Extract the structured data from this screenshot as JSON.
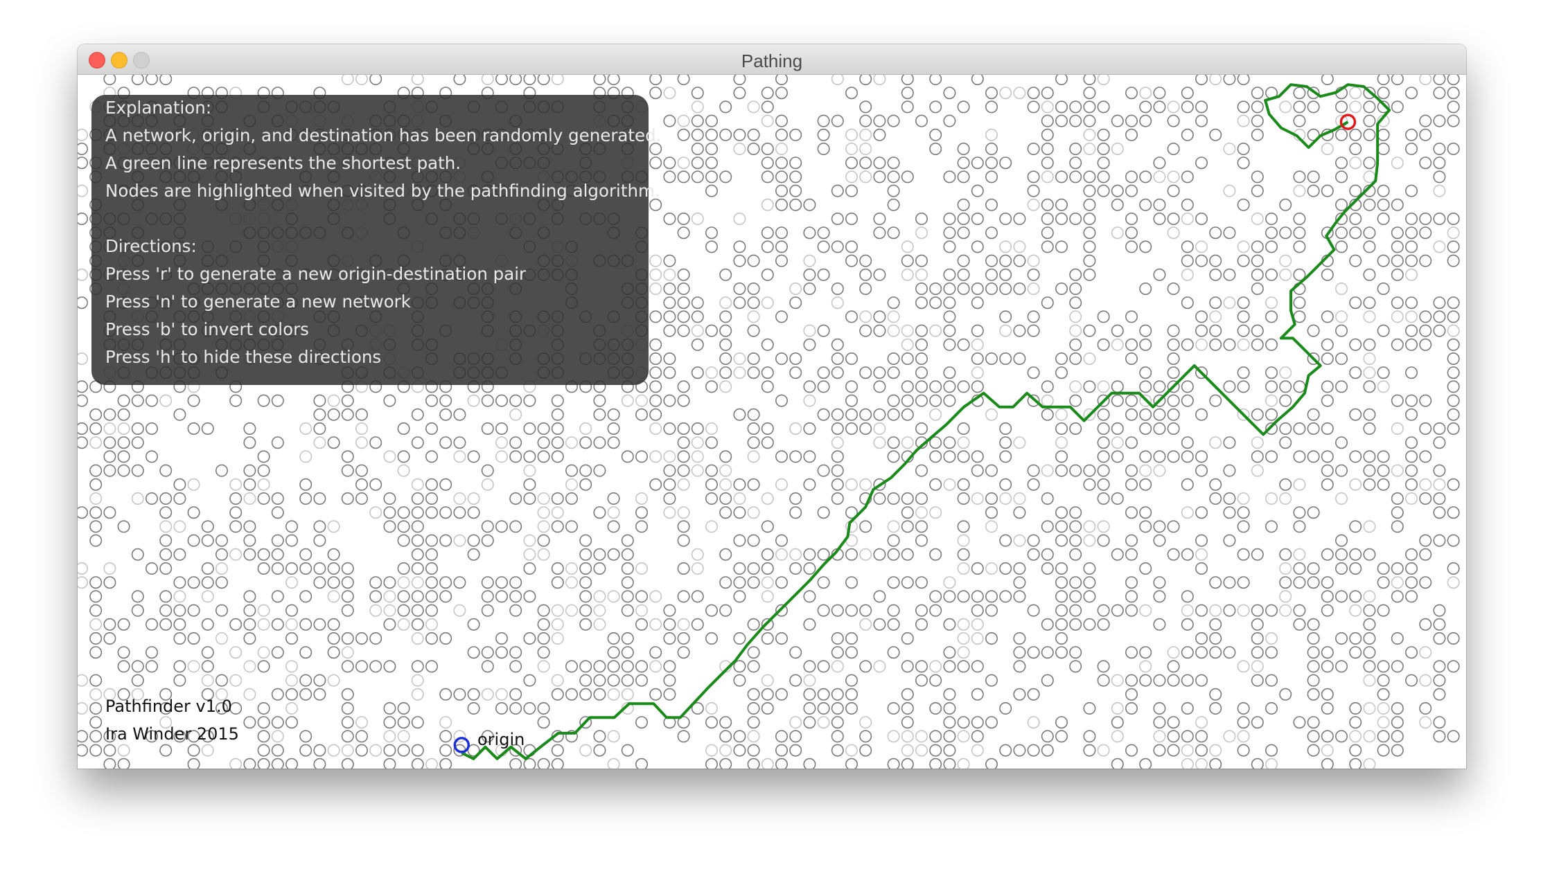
{
  "window": {
    "title": "Pathing"
  },
  "titlebar_buttons": {
    "close": "close-button",
    "minimize": "minimize-button",
    "zoom": "zoom-button"
  },
  "overlay": {
    "explanation_heading": "Explanation:",
    "explanation_lines": [
      "A network, origin, and destination has been randomly generated.",
      "A green line represents the shortest path.",
      "Nodes are highlighted when visited by the pathfinding algorithm."
    ],
    "directions_heading": "Directions:",
    "directions_lines": [
      "Press 'r' to generate a new origin-destination pair",
      "Press 'n' to generate a new network",
      "Press 'b' to invert colors",
      "Press 'h' to hide these directions"
    ]
  },
  "credits": {
    "app": "Pathfinder v1.0",
    "author": "Ira Winder 2015"
  },
  "map": {
    "origin_label": "origin"
  },
  "colors": {
    "path": "#1a8a1a",
    "origin": "#1a2fd6",
    "destination": "#e01a1a",
    "node_visited": "#7a7a7a",
    "node_unvisited": "#c6c6c6",
    "overlay_bg": "#303030"
  }
}
